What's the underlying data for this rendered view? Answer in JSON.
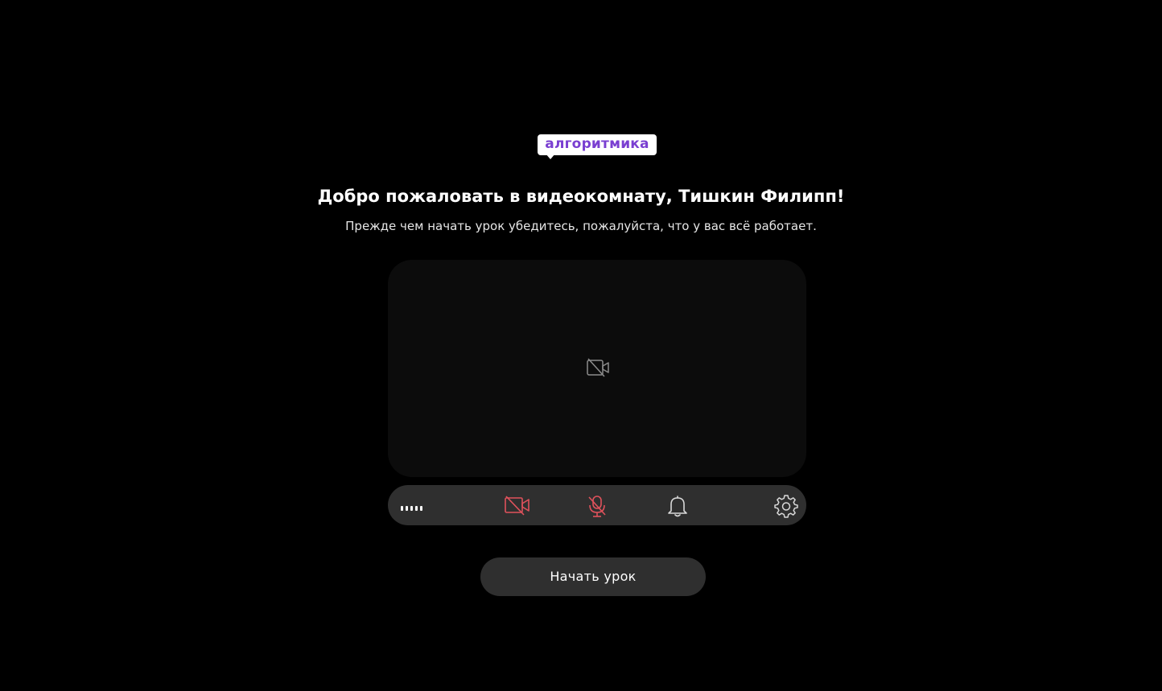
{
  "brand": {
    "logo_text": "алгоритмика"
  },
  "welcome": {
    "title": "Добро пожаловать в видеокомнату, Тишкин Филипп!",
    "subtitle": "Прежде чем начать урок убедитесь, пожалуйста, что у вас всё работает."
  },
  "preview": {
    "icon": "camera-off-icon"
  },
  "toolbar": {
    "audio_level": {
      "icon": "audio-level-icon",
      "bars": 5
    },
    "camera": {
      "icon": "camera-off-icon",
      "state": "off"
    },
    "microphone": {
      "icon": "microphone-off-icon",
      "state": "off"
    },
    "sound_check": {
      "icon": "bell-icon"
    },
    "settings": {
      "icon": "gear-icon"
    }
  },
  "actions": {
    "start_label": "Начать урок"
  },
  "colors": {
    "background": "#000000",
    "preview_bg": "#0c0c0c",
    "toolbar_bg": "#2f2f2f",
    "brand_purple": "#7a3fd1",
    "muted_red": "#e0525c",
    "icon_gray": "#8c8c8c"
  }
}
